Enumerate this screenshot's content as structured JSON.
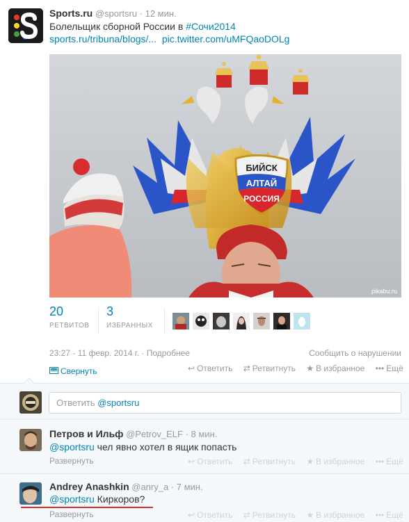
{
  "tweet": {
    "name": "Sports.ru",
    "handle": "@sportsru",
    "time": "· 12 мин.",
    "text_plain": "Болельщик сборной России в ",
    "hashtag": "#Сочи2014",
    "link1": "sports.ru/tribuna/blogs/...",
    "link2": "pic.twitter.com/uMFQaoDOLg",
    "photo_watermark": "pikabu.ru",
    "hat_badge_lines": [
      "БИЙСК",
      "АЛТАЙ",
      "РОССИЯ"
    ],
    "retweets_count": "20",
    "retweets_label": "РЕТВИТОВ",
    "favorites_count": "3",
    "favorites_label": "ИЗБРАННЫХ",
    "datetime": "23:27 - 11 февр. 2014 г.",
    "details": "· Подробнее",
    "report": "Сообщить о нарушении",
    "collapse": "Свернуть",
    "actions": {
      "reply": "Ответить",
      "retweet": "Ретвитнуть",
      "favorite": "В избранное",
      "more": "Ещё"
    }
  },
  "reply_box": {
    "prefix": "Ответить ",
    "mention": "@sportsru"
  },
  "replies": [
    {
      "name": "Петров и Ильф",
      "handle": "@Petrov_ELF",
      "time": "· 8 мин.",
      "mention": "@sportsru",
      "text": " чел явно хотел в ящик попасть",
      "expand": "Развернуть"
    },
    {
      "name": "Andrey Anashkin",
      "handle": "@anry_a",
      "time": "· 7 мин.",
      "mention": "@sportsru",
      "text": " Киркоров?",
      "expand": "Развернуть"
    }
  ],
  "colors": {
    "link": "#0084b4",
    "muted": "#999999",
    "reply_bg": "#f5f8fa",
    "underline": "#d43030"
  }
}
